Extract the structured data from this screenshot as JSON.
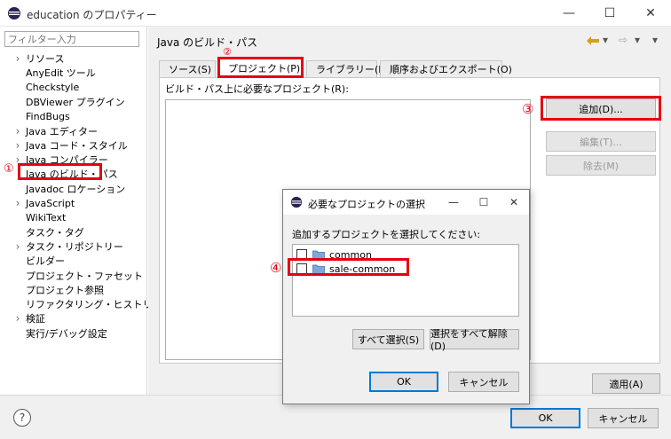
{
  "window": {
    "title": "education のプロパティー",
    "minimize_glyph": "—",
    "maximize_glyph": "☐",
    "close_glyph": "✕"
  },
  "left": {
    "filter_placeholder": "フィルター入力",
    "items": [
      {
        "label": "リソース",
        "expandable": true
      },
      {
        "label": "AnyEdit ツール",
        "expandable": false
      },
      {
        "label": "Checkstyle",
        "expandable": false
      },
      {
        "label": "DBViewer プラグイン",
        "expandable": false
      },
      {
        "label": "FindBugs",
        "expandable": false
      },
      {
        "label": "Java エディター",
        "expandable": true
      },
      {
        "label": "Java コード・スタイル",
        "expandable": true
      },
      {
        "label": "Java コンパイラー",
        "expandable": true
      },
      {
        "label": "Java のビルド・パス",
        "expandable": false
      },
      {
        "label": "Javadoc ロケーション",
        "expandable": false
      },
      {
        "label": "JavaScript",
        "expandable": true
      },
      {
        "label": "WikiText",
        "expandable": false
      },
      {
        "label": "タスク・タグ",
        "expandable": false
      },
      {
        "label": "タスク・リポジトリー",
        "expandable": true
      },
      {
        "label": "ビルダー",
        "expandable": false
      },
      {
        "label": "プロジェクト・ファセット",
        "expandable": false
      },
      {
        "label": "プロジェクト参照",
        "expandable": false
      },
      {
        "label": "リファクタリング・ヒストリー",
        "expandable": false
      },
      {
        "label": "検証",
        "expandable": true
      },
      {
        "label": "実行/デバッグ設定",
        "expandable": false
      }
    ]
  },
  "page": {
    "title": "Java のビルド・パス",
    "nav": {
      "back": "⇦",
      "forward": "⇨",
      "dropdown": "▾"
    },
    "tabs": [
      {
        "label": "ソース(S)"
      },
      {
        "label": "プロジェクト(P)"
      },
      {
        "label": "ライブラリー(L)"
      },
      {
        "label": "順序およびエクスポート(O)"
      }
    ],
    "required_label": "ビルド・パス上に必要なプロジェクト(R):",
    "buttons": {
      "add": "追加(D)...",
      "edit": "編集(T)...",
      "remove": "除去(M)"
    },
    "apply": "適用(A)"
  },
  "bottom": {
    "help": "?",
    "ok": "OK",
    "cancel": "キャンセル"
  },
  "dialog": {
    "title": "必要なプロジェクトの選択",
    "prompt": "追加するプロジェクトを選択してください:",
    "projects": [
      {
        "name": "common",
        "checked": false
      },
      {
        "name": "sale-common",
        "checked": false
      }
    ],
    "select_all": "すべて選択(S)",
    "deselect_all": "選択をすべて解除(D)",
    "ok": "OK",
    "cancel": "キャンセル"
  },
  "annotations": {
    "m1": "①",
    "m2": "②",
    "m3": "③",
    "m4": "④"
  },
  "colors": {
    "annotation": "#e60012",
    "focus": "#0078d7",
    "eclipse_purple": "#2c2255"
  }
}
